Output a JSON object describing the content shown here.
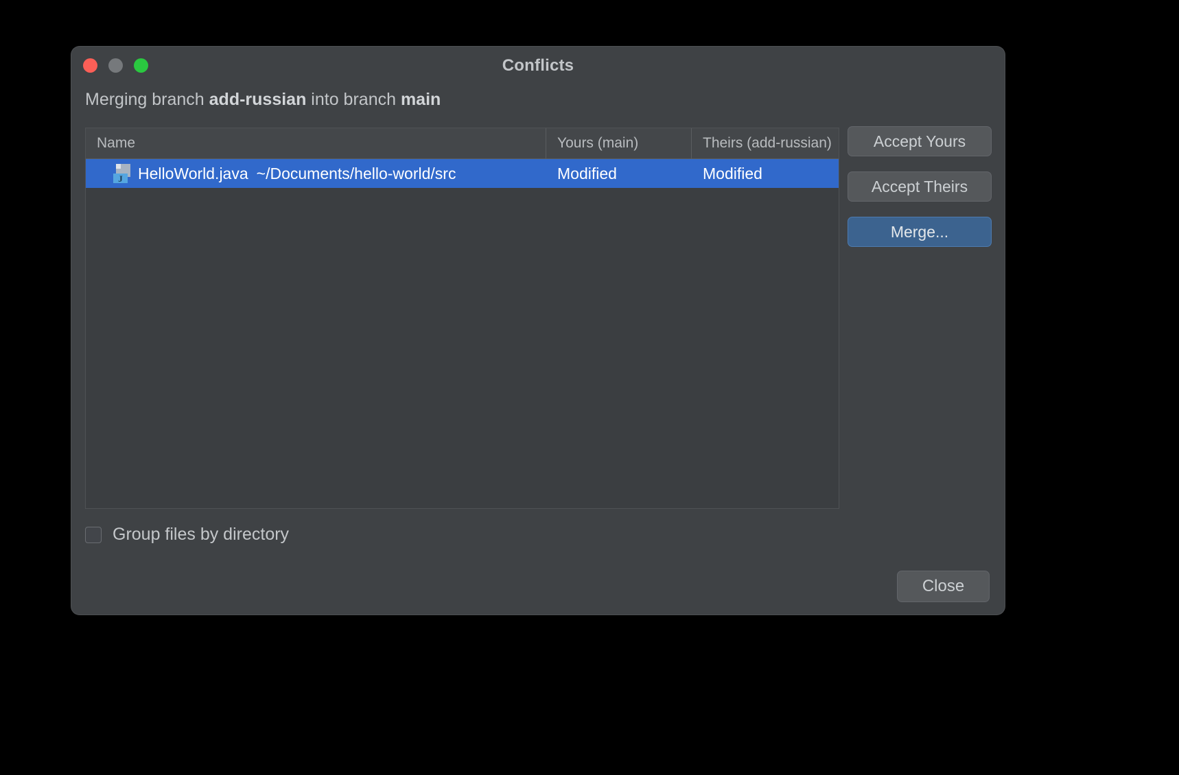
{
  "window": {
    "title": "Conflicts",
    "traffic_lights": [
      "close-button",
      "minimize-button",
      "zoom-button"
    ],
    "accent_color": "#3169cb",
    "background_color": "#3f4245"
  },
  "subtitle": {
    "prefix": "Merging branch ",
    "source_branch": "add-russian",
    "middle": " into branch ",
    "target_branch": "main"
  },
  "table": {
    "columns": [
      {
        "key": "name",
        "label": "Name"
      },
      {
        "key": "yours",
        "label": "Yours (main)"
      },
      {
        "key": "theirs",
        "label": "Theirs (add-russian)"
      }
    ],
    "rows": [
      {
        "icon": "java-file-icon",
        "icon_badge": "J",
        "file_name": "HelloWorld.java",
        "file_path": "~/Documents/hello-world/src",
        "yours": "Modified",
        "theirs": "Modified",
        "selected": true
      }
    ]
  },
  "side_buttons": [
    {
      "id": "accept-yours",
      "label": "Accept Yours",
      "primary": false
    },
    {
      "id": "accept-theirs",
      "label": "Accept Theirs",
      "primary": false
    },
    {
      "id": "merge",
      "label": "Merge...",
      "primary": true
    }
  ],
  "group_checkbox": {
    "label": "Group files by directory",
    "checked": false
  },
  "close_button": {
    "label": "Close"
  }
}
